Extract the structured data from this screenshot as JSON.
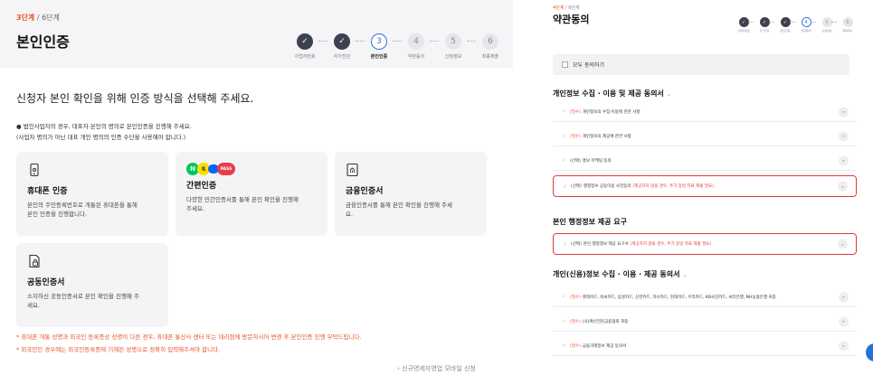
{
  "left": {
    "step_current": "3단계",
    "step_total": " / 6단계",
    "title": "본인인증",
    "steps": [
      {
        "num": "✓",
        "label": "사업자번호",
        "state": "done"
      },
      {
        "num": "✓",
        "label": "자가진단",
        "state": "done"
      },
      {
        "num": "3",
        "label": "본인인증",
        "state": "current"
      },
      {
        "num": "4",
        "label": "약관동의",
        "state": "todo"
      },
      {
        "num": "5",
        "label": "신청정보",
        "state": "todo"
      },
      {
        "num": "6",
        "label": "최종제출",
        "state": "todo"
      }
    ],
    "lead": "신청자 본인 확인을 위해 인증 방식을 선택해 주세요.",
    "note1": "● 법인사업자의 경우, 대표자 본인의 명의로 본인인증을 진행해 주세요.",
    "note2": "(사업자 명의가 아닌 대표 개인 명의의 인증 수단을 사용해야 합니다.)",
    "cards": [
      {
        "title": "휴대폰 인증",
        "desc": "본인의 주민등록번호로 개통된 휴대폰을 통해 본인 인증을 진행합니다."
      },
      {
        "title": "간편인증",
        "desc": "다양한 민간인증서를 통해 본인 확인을 진행해 주세요."
      },
      {
        "title": "금융인증서",
        "desc": "금융인증서를 통해 본인 확인을 진행해 주세요."
      },
      {
        "title": "공동인증서",
        "desc": "소지하신 공동인증서로 본인 확인을 진행해 주세요."
      }
    ],
    "badges": [
      "N",
      "톡",
      "",
      "PASS"
    ],
    "warnings": [
      "* 휴대폰 개통 성명과 외국인 등록증상 성명이 다른 경우, 휴대폰 통신사 센터 또는 대리점에 방문하시어 변경 후 본인인증 진행 부탁드립니다.",
      "* 외국인인 경우에는 외국인등록증에 기재된 성명으로 정확히 입력해주셔야 합니다."
    ]
  },
  "right": {
    "step_current": "4단계",
    "step_total": " / 6단계",
    "title": "약관동의",
    "steps": [
      {
        "num": "✓",
        "label": "사업자번호",
        "state": "done"
      },
      {
        "num": "✓",
        "label": "자가진단",
        "state": "done"
      },
      {
        "num": "✓",
        "label": "본인인증",
        "state": "done"
      },
      {
        "num": "4",
        "label": "약관동의",
        "state": "current"
      },
      {
        "num": "5",
        "label": "신청정보",
        "state": "todo"
      },
      {
        "num": "6",
        "label": "최종제출",
        "state": "todo"
      }
    ],
    "agree_all": "모두 동의하기",
    "section1": "개인정보 수집 · 이용 및 제공 동의서",
    "section1_items": [
      {
        "tag": "(필수)",
        "text": "개인정보의 수집·이용에 관한 사항",
        "red": ""
      },
      {
        "tag": "(필수)",
        "text": "개인정보의 제공에 관한 사항",
        "red": ""
      },
      {
        "tag": "(선택)",
        "text": "홍보 마케팅 동의",
        "red": ""
      },
      {
        "tag": "(선택)",
        "text": "행정정보 공동이용 사전동의",
        "red": "(제공하지 않을 경우, 추가 증빙 자료 제출 필요)"
      }
    ],
    "section2": "본인 행정정보 제공 요구",
    "section2_items": [
      {
        "tag": "(선택)",
        "text": "본인 행정정보 제공 요구서",
        "red": "(제공하지 않을 경우, 추가 증빙 자료 제출 필요)"
      }
    ],
    "section3": "개인(신용)정보 수집 · 이용 · 제공 동의서",
    "section3_items": [
      {
        "tag": "(필수)",
        "text": "롯데카드, 비씨카드, 삼성카드, 신한카드, 하나카드, 현대카드, 우리카드, KB국민카드, 씨티은행, NH농협은행 귀중",
        "red": ""
      },
      {
        "tag": "(필수)",
        "text": "(사)여신전문금융협회 귀중",
        "red": ""
      },
      {
        "tag": "(필수)",
        "text": "금융거래정보 제공 동의서",
        "red": ""
      }
    ]
  },
  "caption": "‹ 신규영세자영업 모바일 신청",
  "colors": {
    "accent": "#e8542b",
    "primary": "#3b6fe0",
    "alert": "#e03a3a"
  }
}
